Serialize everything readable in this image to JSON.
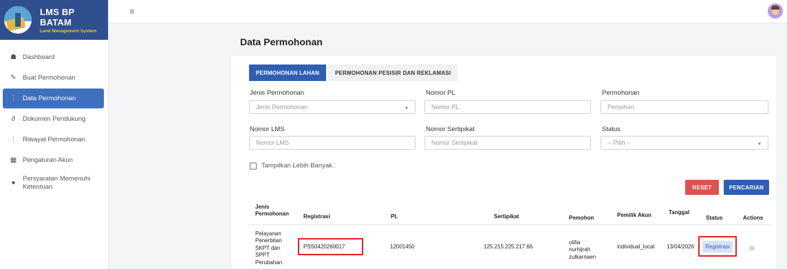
{
  "brand": {
    "title": "LMS BP BATAM",
    "subtitle": "Land Management System"
  },
  "sidebar": {
    "items": [
      {
        "label": "Dashboard",
        "icon": "dashboard-icon",
        "glyph": "☗",
        "active": false
      },
      {
        "label": "Buat Permohonan",
        "icon": "edit-icon",
        "glyph": "✎",
        "active": false
      },
      {
        "label": "Data Permohonan",
        "icon": "list-icon",
        "glyph": "⋮",
        "active": true
      },
      {
        "label": "Dokumen Pendukung",
        "icon": "link-icon",
        "glyph": "∂",
        "active": false
      },
      {
        "label": "Riwayat Permohonan",
        "icon": "history-icon",
        "glyph": "⋮",
        "active": false
      },
      {
        "label": "Pengaturan Akun",
        "icon": "settings-icon",
        "glyph": "▦",
        "active": false
      },
      {
        "label": "Persyaratan Memenuhi Ketentuan",
        "icon": "check-circle-icon",
        "glyph": "●",
        "active": false
      }
    ]
  },
  "topbar": {
    "menu_glyph": "≡"
  },
  "page": {
    "title": "Data Permohonan"
  },
  "tabs": [
    {
      "label": "PERMOHONAN LAHAN",
      "active": true
    },
    {
      "label": "PERMOHONAN PESISIR DAN REKLAMASI",
      "active": false
    }
  ],
  "filters": {
    "jenis_permohonan": {
      "label": "Jenis Permohonan",
      "placeholder": "Jenis Permohonan"
    },
    "nomor_pl": {
      "label": "Nomor PL",
      "placeholder": "Nomor PL"
    },
    "pemohon": {
      "label": "Permohonan",
      "placeholder": "Pemohon"
    },
    "nomor_lms": {
      "label": "Nomor LMS",
      "placeholder": "Nomor LMS"
    },
    "nomor_sertipikat": {
      "label": "Nomor Sertipikat",
      "placeholder": "Nomor Sertipikat"
    },
    "status": {
      "label": "Status",
      "placeholder": "-- Pilih --"
    },
    "show_more": "Tampilkan Lebih Banyak"
  },
  "buttons": {
    "reset": "RESET",
    "search": "PENCARIAN"
  },
  "table": {
    "headers": {
      "jenis": "Jenis Permohonan",
      "registrasi": "Registrasi",
      "pl": "PL",
      "sertipikat": "Sertipikat",
      "pemohon": "Pemohon",
      "pemilik_akun": "Pemilik Akun",
      "tanggal": "Tanggal",
      "status": "Status",
      "actions": "Actions"
    },
    "rows": [
      {
        "jenis": "Pelayanan Penerbitan SKPT dan SPPT Perubahan",
        "registrasi": "PSS0420260017",
        "pl": "12001450",
        "sertipikat": "125.215.225.217.66",
        "pemohon": "olifia nurhijrah zulkarnaen",
        "pemilik_akun": "individual_local",
        "tanggal": "13/04/2026",
        "status": "Registrasi"
      }
    ]
  }
}
